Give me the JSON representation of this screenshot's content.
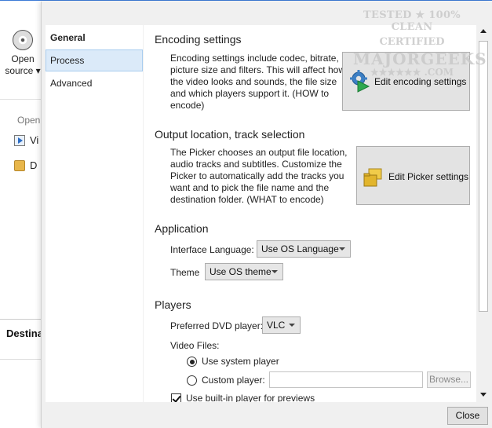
{
  "background_app": {
    "open_source_line1": "Open",
    "open_source_line2": "source ▾",
    "open_header": "Open",
    "item_video": "Vi",
    "item_dvd": "D",
    "destination": "Destina"
  },
  "nav": {
    "items": [
      {
        "label": "General"
      },
      {
        "label": "Process"
      },
      {
        "label": "Advanced"
      }
    ],
    "selected": "Process"
  },
  "encoding": {
    "title": "Encoding settings",
    "description": "Encoding settings include codec, bitrate, picture size and filters. This will affect how the video looks and sounds, the file size and which players support it. (HOW to encode)",
    "button_label": "Edit encoding settings",
    "button_icon": "gear-play-icon"
  },
  "output": {
    "title": "Output location, track selection",
    "description": "The Picker chooses an output file location, audio tracks and subtitles. Customize the Picker to automatically add the tracks you want and to pick the file name and the destination folder. (WHAT to encode)",
    "button_label": "Edit Picker settings",
    "button_icon": "folders-icon"
  },
  "application": {
    "title": "Application",
    "language_label": "Interface Language:",
    "language_value": "Use OS Language",
    "theme_label": "Theme",
    "theme_value": "Use OS theme"
  },
  "players": {
    "title": "Players",
    "dvd_label": "Preferred DVD player:",
    "dvd_value": "VLC",
    "video_files_label": "Video Files:",
    "use_system_label": "Use system player",
    "custom_player_label": "Custom player:",
    "custom_player_value": "",
    "browse_label": "Browse...",
    "builtin_label": "Use built-in player for previews",
    "use_system_selected": true,
    "builtin_checked": true
  },
  "footer": {
    "close_label": "Close"
  },
  "watermark": {
    "line1": "TESTED ★ 100% CLEAN",
    "line2": "CERTIFIED",
    "line3": "MAJORGEEKS",
    "line4": "★★★★★★ .COM"
  }
}
